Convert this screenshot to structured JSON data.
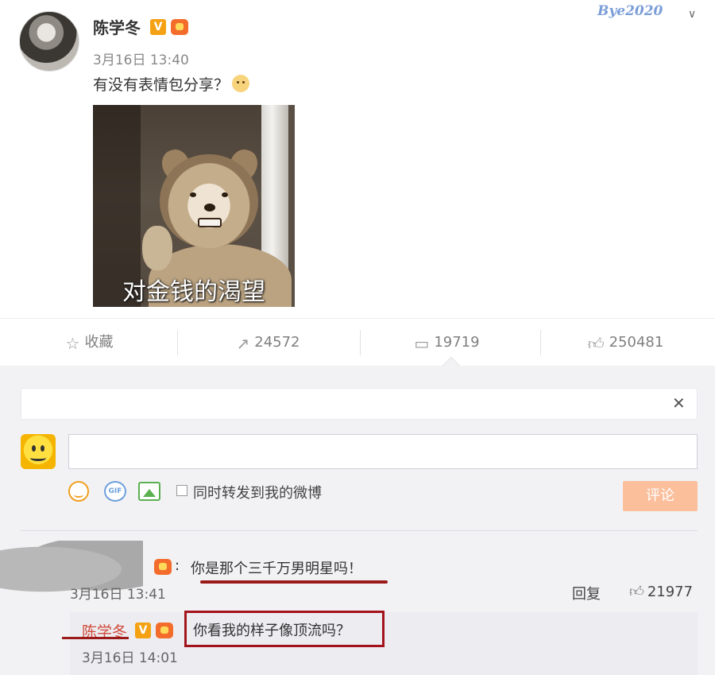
{
  "watermark": "Bye2020",
  "post": {
    "author": "陈学冬",
    "verified_badge": "V",
    "time": "3月16日 13:40",
    "text": "有没有表情包分享？",
    "image_caption": "对金钱的渴望"
  },
  "actions": {
    "favorite_label": "收藏",
    "forward_count": "24572",
    "comment_count": "19719",
    "like_count": "250481"
  },
  "composer": {
    "input_value": "",
    "repost_label": "同时转发到我的微博",
    "submit_label": "评论"
  },
  "comments": [
    {
      "author": "",
      "text": "你是那个三千万男明星吗！",
      "time": "3月16日 13:41",
      "reply_label": "回复",
      "like_count": "21977",
      "replies": [
        {
          "author": "陈学冬",
          "badge": "V",
          "text": "你看我的样子像顶流吗？",
          "time": "3月16日 14:01"
        }
      ]
    }
  ],
  "colors": {
    "accent_orange": "#f4a113",
    "highlight_red": "#a3131c",
    "submit_button": "#fbbf9c",
    "reply_author": "#d14a3a"
  },
  "icons": [
    "star-icon",
    "forward-icon",
    "comment-icon",
    "thumbs-up-icon",
    "close-icon",
    "emoji-icon",
    "gif-icon",
    "image-icon",
    "chevron-down-icon"
  ]
}
